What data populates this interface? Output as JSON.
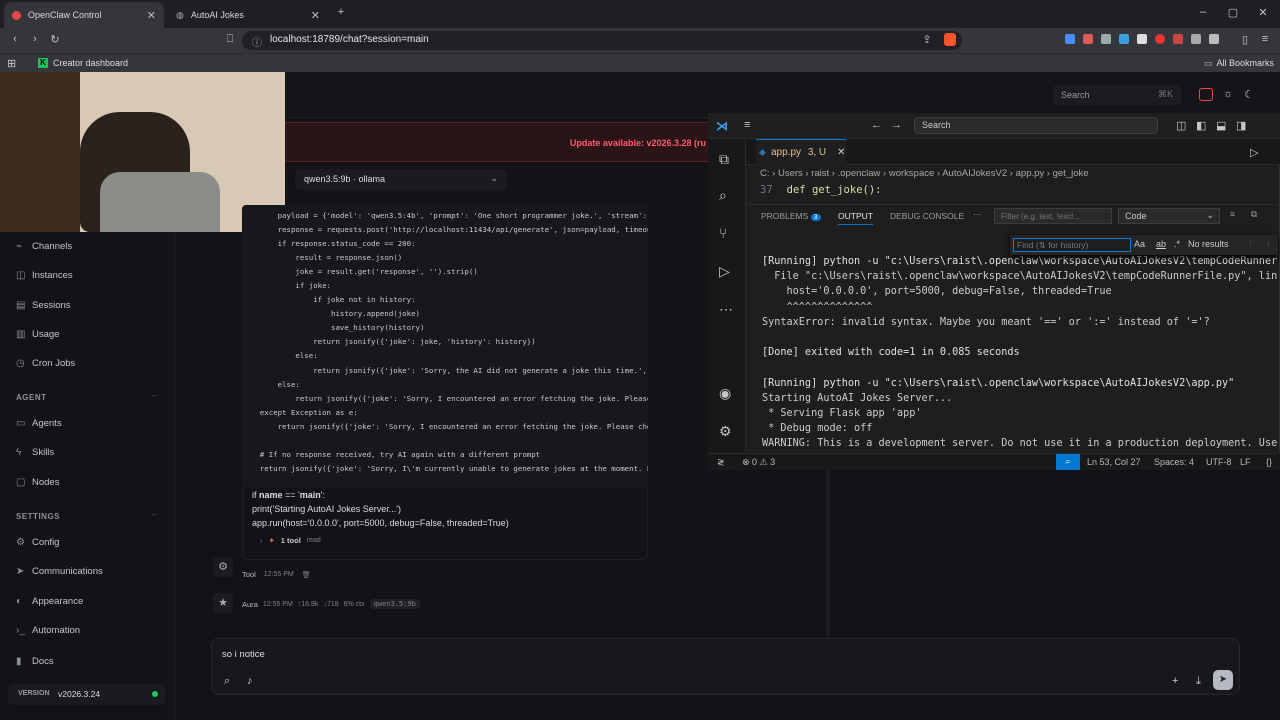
{
  "browser": {
    "tabs": [
      {
        "title": "OpenClaw Control"
      },
      {
        "title": "AutoAI Jokes"
      }
    ],
    "url": "localhost:18789/chat?session=main",
    "bookmarks": {
      "item": "Creator dashboard",
      "all": "All Bookmarks"
    }
  },
  "topbar": {
    "search_placeholder": "Search",
    "search_shortcut": "⌘K"
  },
  "update": {
    "label": "Update available: v2026.3.28 (ru"
  },
  "sidebar": {
    "items": [
      {
        "label": "Channels"
      },
      {
        "label": "Instances"
      },
      {
        "label": "Sessions"
      },
      {
        "label": "Usage"
      },
      {
        "label": "Cron Jobs"
      }
    ],
    "agent_section": "AGENT",
    "agent_items": [
      {
        "label": "Agents"
      },
      {
        "label": "Skills"
      },
      {
        "label": "Nodes"
      }
    ],
    "settings_section": "SETTINGS",
    "settings_items": [
      {
        "label": "Config"
      },
      {
        "label": "Communications"
      },
      {
        "label": "Appearance"
      },
      {
        "label": "Automation"
      },
      {
        "label": "Docs"
      }
    ],
    "version_label": "VERSION",
    "version_value": "v2026.3.24"
  },
  "chat": {
    "model_select": "qwen3.5:9b · ollama",
    "code_lines": [
      "        payload = {'model': 'qwen3.5:4b', 'prompt': 'One short programmer joke.', 'stream':",
      "        response = requests.post('http://localhost:11434/api/generate', json=payload, timeou",
      "        if response.status_code == 200:",
      "            result = response.json()",
      "            joke = result.get('response', '').strip()",
      "            if joke:",
      "                if joke not in history:",
      "                    history.append(joke)",
      "                    save_history(history)",
      "                return jsonify({'joke': joke, 'history': history})",
      "            else:",
      "                return jsonify({'joke': 'Sorry, the AI did not generate a joke this time.',",
      "        else:",
      "            return jsonify({'joke': 'Sorry, I encountered an error fetching the joke. Please",
      "    except Exception as e:",
      "        return jsonify({'joke': 'Sorry, I encountered an error fetching the joke. Please che",
      "",
      "    # If no response received, try AI again with a different prompt",
      "    return jsonify({'joke': 'Sorry, I\\'m currently unable to generate jokes at the moment. P"
    ],
    "tail_line1_pre": "if ",
    "tail_line1_bold1": "name",
    "tail_line1_mid": " == '",
    "tail_line1_bold2": "main",
    "tail_line1_post": "':",
    "tail_line2": "print('Starting AutoAI Jokes Server...')",
    "tail_line3": "app.run(host='0.0.0.0', port=5000, debug=False, threaded=True)",
    "tool_count": "1 tool",
    "tool_action": "read",
    "tool_msg": {
      "name": "Tool",
      "time": "12:55 PM"
    },
    "aura_msg": {
      "name": "Aura",
      "time": "12:55 PM",
      "tokens_in": "↑16.8k",
      "tokens_out": "↓718",
      "ctx": "6% ctx",
      "model": "qwen3.5:9b"
    },
    "composer_text": "so i notice"
  },
  "vscode": {
    "search": "Search",
    "tab": {
      "name": "app.py",
      "badge": "3, U"
    },
    "breadcrumb": [
      "C:",
      "Users",
      "raist",
      ".openclaw",
      "workspace",
      "AutoAIJokesV2",
      "app.py",
      "get_joke"
    ],
    "sticky_line_no": "37",
    "sticky_code": "def get_joke():",
    "panel_tabs": {
      "problems": "PROBLEMS",
      "problems_count": "3",
      "output": "OUTPUT",
      "debug": "DEBUG CONSOLE"
    },
    "filter_placeholder": "Filter (e.g. text, !excl...",
    "channel": "Code",
    "find_placeholder": "Find (⇅ for history)",
    "find_result": "No results",
    "output_lines": [
      "[Running] python -u \"c:\\Users\\raist\\.openclaw\\workspace\\AutoAIJokesV2\\tempCodeRunner",
      "  File \"c:\\Users\\raist\\.openclaw\\workspace\\AutoAIJokesV2\\tempCodeRunnerFile.py\", lin",
      "    host='0.0.0.0', port=5000, debug=False, threaded=True",
      "    ^^^^^^^^^^^^^^",
      "SyntaxError: invalid syntax. Maybe you meant '==' or ':=' instead of '='?",
      "",
      "[Done] exited with code=1 in 0.085 seconds",
      "",
      "[Running] python -u \"c:\\Users\\raist\\.openclaw\\workspace\\AutoAIJokesV2\\app.py\"",
      "Starting AutoAI Jokes Server...",
      " * Serving Flask app 'app'",
      " * Debug mode: off",
      "WARNING: This is a development server. Do not use it in a production deployment. Use"
    ],
    "status": {
      "errors": "0",
      "warnings": "3",
      "pos": "Ln 53, Col 27",
      "spaces": "Spaces: 4",
      "enc": "UTF-8",
      "eol": "LF"
    }
  },
  "colors": {
    "accent": "#ff5c6c",
    "vscode_blue": "#0078d4",
    "green": "#22c55e"
  }
}
